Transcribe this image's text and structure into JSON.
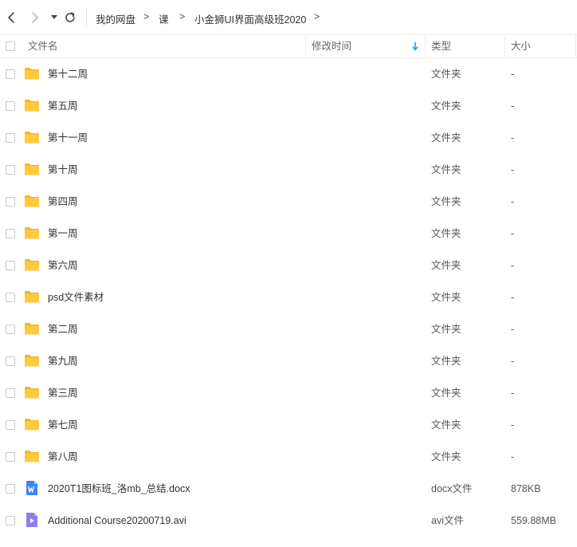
{
  "toolbar": {
    "icons": [
      "back-icon",
      "forward-icon",
      "dropdown-caret-icon",
      "refresh-icon"
    ],
    "breadcrumb": [
      "我的网盘",
      "课",
      "小金狮UI界面高级班2020"
    ],
    "separator": ">"
  },
  "columns": {
    "name": "文件名",
    "modified": "修改时间",
    "type": "类型",
    "size": "大小",
    "sort_icon": "sort-down-arrow-icon"
  },
  "colors": {
    "folder": "#FFCB3D",
    "folder_back": "#F5B72A",
    "docx": "#3B86F5",
    "avi": "#8B7CF2",
    "sort_arrow": "#2E9AE6"
  },
  "files": [
    {
      "name": "第十二周",
      "type": "文件夹",
      "size": "-",
      "icon": "folder-icon"
    },
    {
      "name": "第五周",
      "type": "文件夹",
      "size": "-",
      "icon": "folder-icon"
    },
    {
      "name": "第十一周",
      "type": "文件夹",
      "size": "-",
      "icon": "folder-icon"
    },
    {
      "name": "第十周",
      "type": "文件夹",
      "size": "-",
      "icon": "folder-icon"
    },
    {
      "name": "第四周",
      "type": "文件夹",
      "size": "-",
      "icon": "folder-icon"
    },
    {
      "name": "第一周",
      "type": "文件夹",
      "size": "-",
      "icon": "folder-icon"
    },
    {
      "name": "第六周",
      "type": "文件夹",
      "size": "-",
      "icon": "folder-icon"
    },
    {
      "name": "psd文件素材",
      "type": "文件夹",
      "size": "-",
      "icon": "folder-icon"
    },
    {
      "name": "第二周",
      "type": "文件夹",
      "size": "-",
      "icon": "folder-icon"
    },
    {
      "name": "第九周",
      "type": "文件夹",
      "size": "-",
      "icon": "folder-icon"
    },
    {
      "name": "第三周",
      "type": "文件夹",
      "size": "-",
      "icon": "folder-icon"
    },
    {
      "name": "第七周",
      "type": "文件夹",
      "size": "-",
      "icon": "folder-icon"
    },
    {
      "name": "第八周",
      "type": "文件夹",
      "size": "-",
      "icon": "folder-icon"
    },
    {
      "name": "2020T1图标班_洛mb_总结.docx",
      "type": "docx文件",
      "size": "878KB",
      "icon": "word-doc-icon"
    },
    {
      "name": "Additional Course20200719.avi",
      "type": "avi文件",
      "size": "559.88MB",
      "icon": "video-file-icon"
    }
  ]
}
